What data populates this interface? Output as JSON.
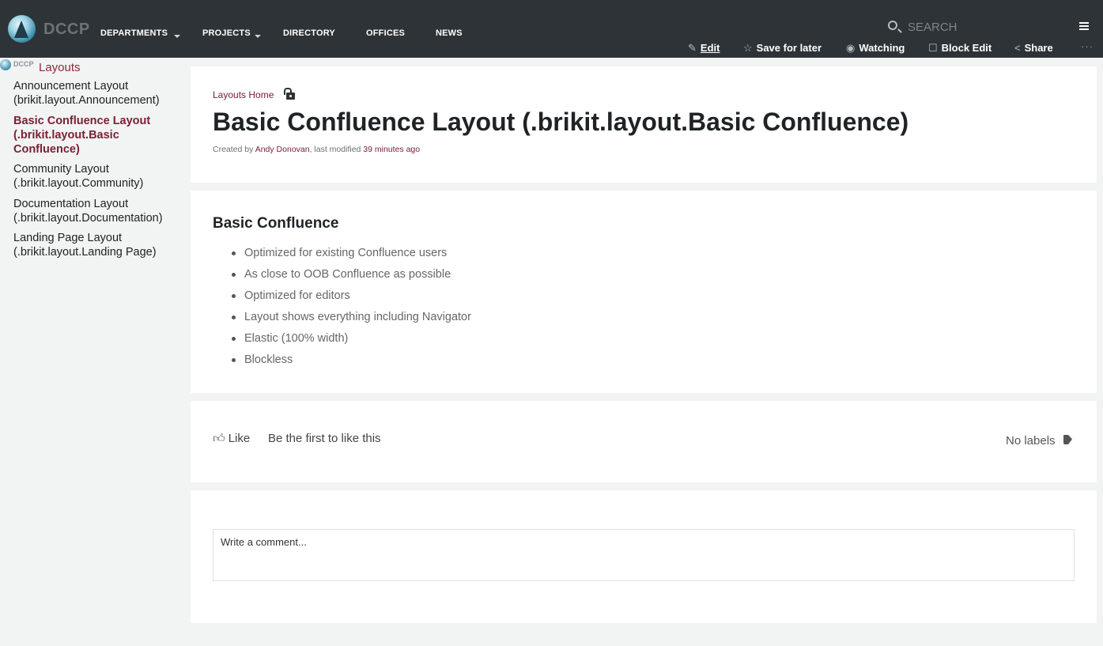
{
  "header": {
    "brand": "DCCP",
    "nav": [
      {
        "label": "DEPARTMENTS",
        "has_caret": true
      },
      {
        "label": "PROJECTS",
        "has_caret": true
      },
      {
        "label": "DIRECTORY",
        "has_caret": false
      },
      {
        "label": "OFFICES",
        "has_caret": false
      },
      {
        "label": "NEWS",
        "has_caret": false
      }
    ],
    "search_placeholder": "SEARCH",
    "actions": [
      {
        "label": "Edit",
        "icon": "pencil-icon"
      },
      {
        "label": "Save for later",
        "icon": "star-icon"
      },
      {
        "label": "Watching",
        "icon": "eye-icon"
      },
      {
        "label": "Block Edit",
        "icon": "edit-square-icon"
      },
      {
        "label": "Share",
        "icon": "share-icon"
      }
    ],
    "more": "···"
  },
  "sidebar": {
    "brand": "DCCP",
    "title": "Layouts",
    "items": [
      {
        "label": "Announcement Layout (brikit.layout.Announcement)",
        "active": false
      },
      {
        "label": "Basic Confluence Layout (.brikit.layout.Basic Confluence)",
        "active": true
      },
      {
        "label": "Community Layout (.brikit.layout.Community)",
        "active": false
      },
      {
        "label": "Documentation Layout (.brikit.layout.Documentation)",
        "active": false
      },
      {
        "label": "Landing Page Layout (.brikit.layout.Landing Page)",
        "active": false
      }
    ]
  },
  "page": {
    "breadcrumb": "Layouts Home",
    "title": "Basic Confluence Layout (.brikit.layout.Basic Confluence)",
    "byline_prefix": "Created by ",
    "author": "Andy Donovan",
    "byline_mid": ", last modified ",
    "modified": "39 minutes ago"
  },
  "content": {
    "heading": "Basic Confluence",
    "bullets": [
      "Optimized for existing Confluence users",
      "As close to OOB Confluence as possible",
      "Optimized for editors",
      "Layout shows everything including Navigator",
      "Elastic (100% width)",
      "Blockless"
    ]
  },
  "footer": {
    "like_label": "Like",
    "first_like": "Be the first to like this",
    "labels": "No labels"
  },
  "comment": {
    "placeholder": "Write a comment..."
  },
  "colors": {
    "topbar": "#2d3337",
    "accent": "#7b2035",
    "page_bg": "#f2f3f3"
  }
}
